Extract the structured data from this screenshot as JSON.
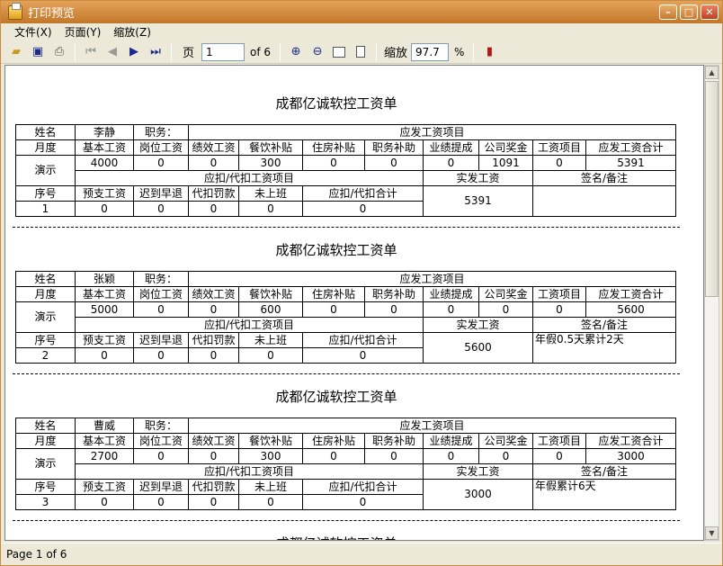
{
  "window": {
    "title": "打印预览"
  },
  "menu": [
    "文件(X)",
    "页面(Y)",
    "缩放(Z)"
  ],
  "toolbar": {
    "page_label": "页",
    "page_value": "1",
    "page_of": "of 6",
    "zoom_label": "缩放",
    "zoom_value": "97.7",
    "zoom_unit": "%"
  },
  "status": {
    "text": "Page 1 of 6"
  },
  "labels": {
    "name": "姓名",
    "position": "职务：",
    "payable": "应发工资项目",
    "month": "月度",
    "demo": "演示",
    "deduct": "应扣/代扣工资项目",
    "actual": "实发工资",
    "sign": "签名/备注",
    "seq": "序号",
    "cols1": [
      "基本工资",
      "岗位工资",
      "绩效工资",
      "餐饮补贴",
      "住房补贴",
      "职务补助",
      "业绩提成",
      "公司奖金",
      "工资项目",
      "应发工资合计"
    ],
    "cols2": [
      "预支工资",
      "迟到早退",
      "代扣罚款",
      "未上班",
      "应扣/代扣合计"
    ]
  },
  "slips": [
    {
      "title": "成都亿诚软控工资单",
      "name": "李静",
      "values1": [
        "4000",
        "0",
        "0",
        "300",
        "0",
        "0",
        "0",
        "1091",
        "0",
        "5391"
      ],
      "seq": "1",
      "values2": [
        "0",
        "0",
        "0",
        "0",
        "0"
      ],
      "actual": "5391",
      "note": ""
    },
    {
      "title": "成都亿诚软控工资单",
      "name": "张颖",
      "values1": [
        "5000",
        "0",
        "0",
        "600",
        "0",
        "0",
        "0",
        "0",
        "0",
        "5600"
      ],
      "seq": "2",
      "values2": [
        "0",
        "0",
        "0",
        "0",
        "0"
      ],
      "actual": "5600",
      "note": "年假0.5天累计2天"
    },
    {
      "title": "成都亿诚软控工资单",
      "name": "曹威",
      "values1": [
        "2700",
        "0",
        "0",
        "300",
        "0",
        "0",
        "0",
        "0",
        "0",
        "3000"
      ],
      "seq": "3",
      "values2": [
        "0",
        "0",
        "0",
        "0",
        "0"
      ],
      "actual": "3000",
      "note": "年假累计6天"
    },
    {
      "title": "成都亿诚软控工资单"
    }
  ]
}
